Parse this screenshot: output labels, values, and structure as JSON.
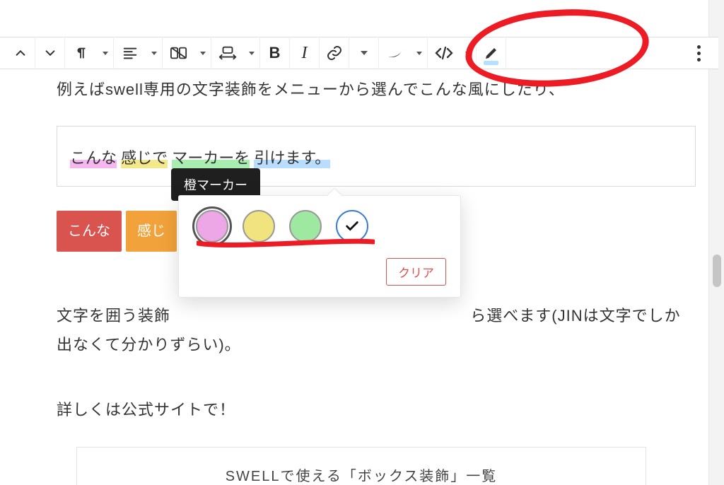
{
  "toolbar": {
    "items": [
      {
        "name": "move-up",
        "interactable": true
      },
      {
        "name": "move-down",
        "interactable": true
      },
      {
        "name": "paragraph",
        "interactable": true,
        "dropdown": true
      },
      {
        "name": "align",
        "interactable": true,
        "dropdown": true
      },
      {
        "name": "columns",
        "interactable": true,
        "dropdown": true
      },
      {
        "name": "width",
        "interactable": true,
        "dropdown": true
      },
      {
        "name": "bold",
        "interactable": true
      },
      {
        "name": "italic",
        "interactable": true
      },
      {
        "name": "link",
        "interactable": true
      },
      {
        "name": "text-dropdown",
        "interactable": true
      },
      {
        "name": "swell-style",
        "interactable": true,
        "dropdown": true
      },
      {
        "name": "code-block",
        "interactable": true,
        "dropdown": true
      },
      {
        "name": "highlighter",
        "interactable": true
      },
      {
        "name": "more-options",
        "interactable": true
      }
    ]
  },
  "content": {
    "intro": "例えばswell専用の文字装飾をメニューから選んでこんな風にしたり、",
    "marker_line": {
      "seg1": "こんな",
      "seg2": "感じで",
      "seg3": "マーカーを",
      "seg4": "引けます。"
    },
    "badges": {
      "red": "こんな",
      "orange": "感じ"
    },
    "para2a": "文字を囲う装飾",
    "para2b": "ら選べます(JINは文字でしか出なくて分かりずらい)。",
    "para3": "詳しくは公式サイトで！",
    "bottom_card": "SWELLで使える「ボックス装飾」一覧"
  },
  "popover": {
    "tooltip": "橙マーカー",
    "swatches": [
      "pink",
      "yellow",
      "green",
      "check"
    ],
    "clear_label": "クリア"
  },
  "colors": {
    "annotation_red": "#ed1c24"
  }
}
